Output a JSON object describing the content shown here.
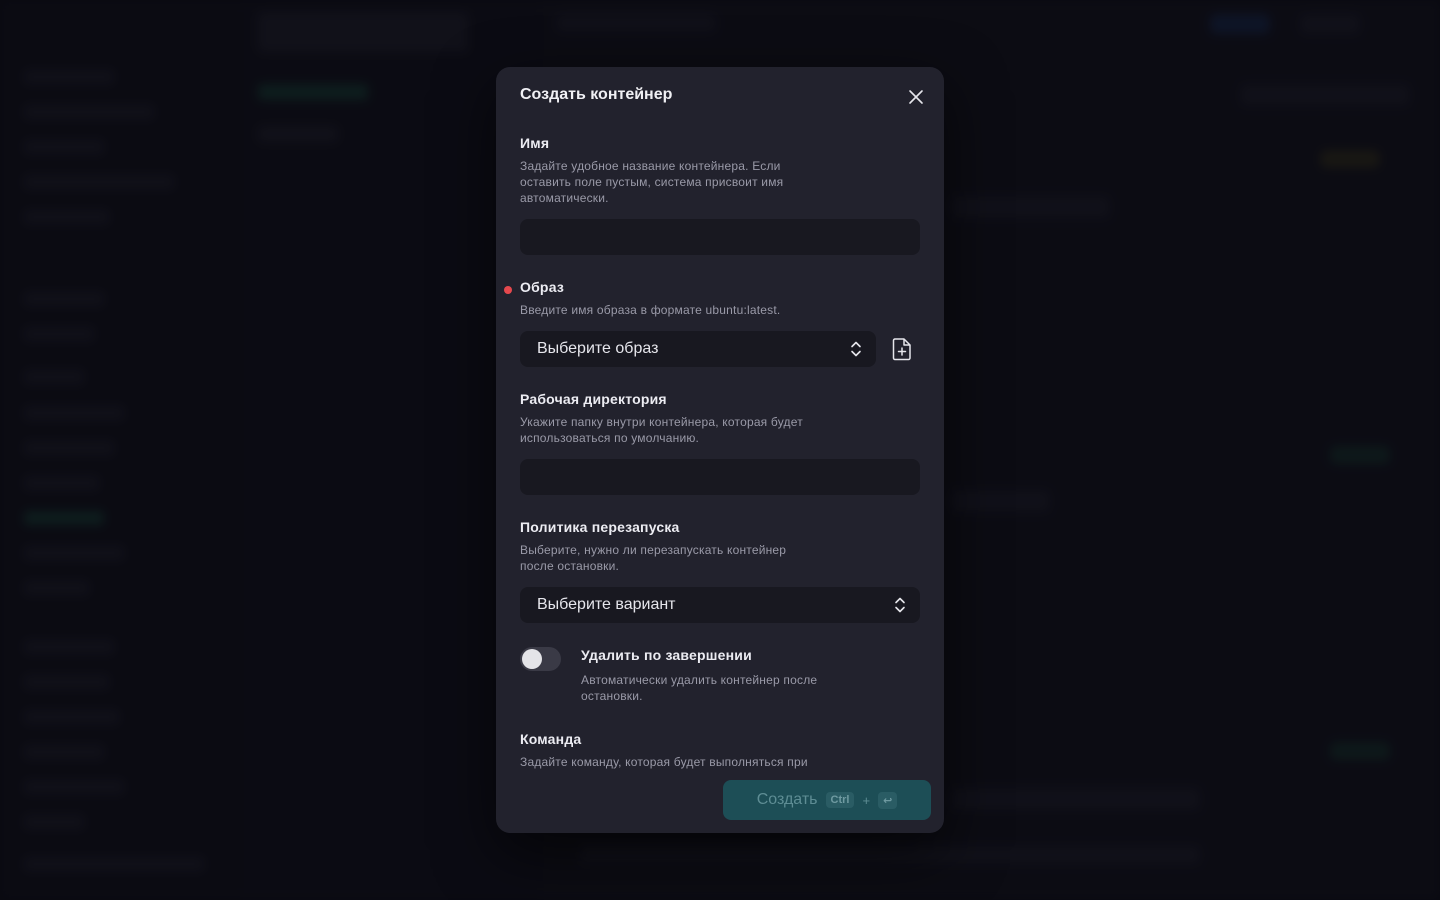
{
  "modal": {
    "title": "Создать контейнер",
    "fields": {
      "name": {
        "label": "Имя",
        "description": "Задайте удобное название контейнера. Если оставить поле пустым, система присвоит имя автоматически.",
        "value": "",
        "placeholder": ""
      },
      "image": {
        "label": "Образ",
        "description": "Введите имя образа в формате ubuntu:latest.",
        "selected": "Выберите образ",
        "required": true
      },
      "workdir": {
        "label": "Рабочая директория",
        "description": "Укажите папку внутри контейнера, которая будет использоваться по умолчанию.",
        "value": "",
        "placeholder": ""
      },
      "restart_policy": {
        "label": "Политика перезапуска",
        "description": "Выберите, нужно ли перезапускать контейнер после остановки.",
        "selected": "Выберите вариант"
      },
      "auto_remove": {
        "label": "Удалить по завершении",
        "description": "Автоматически удалить контейнер после остановки.",
        "enabled": false
      },
      "command": {
        "label": "Команда",
        "description": "Задайте команду, которая будет выполняться при"
      }
    },
    "footer": {
      "create_label": "Создать",
      "shortcut_key": "Ctrl",
      "shortcut_plus": "+",
      "shortcut_enter": "↩"
    }
  },
  "colors": {
    "modal_bg": "#22222d",
    "input_bg": "#181820",
    "required_dot": "#e5484d",
    "create_button_bg": "#1d4e56"
  }
}
